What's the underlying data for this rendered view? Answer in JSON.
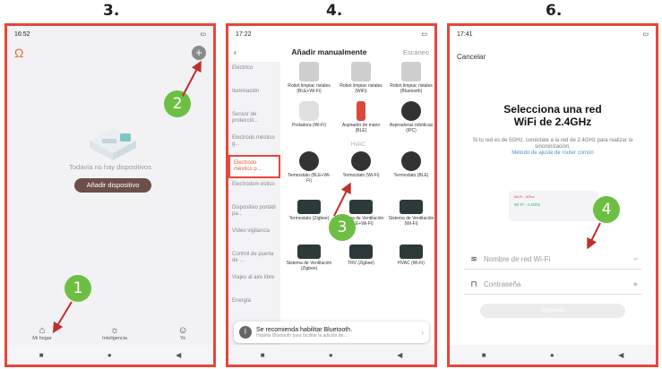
{
  "steps": [
    "3.",
    "4.",
    "6."
  ],
  "markers": [
    "1",
    "2",
    "3",
    "4"
  ],
  "phone1": {
    "time": "16:52",
    "signal": "ail",
    "empty_text": "Todavía no hay dispositivos",
    "add_device": "Añadir dispositivo",
    "tabs": [
      "Mi hogar",
      "Inteligencia",
      "Yo"
    ]
  },
  "phone2": {
    "time": "17:22",
    "title": "Añadir manualmente",
    "scan": "Escaneo",
    "categories": [
      "Eléctrico",
      "Iluminación",
      "Sensor de protecció...",
      "Electrodo méstico g...",
      "Electrodo méstico p...",
      "Electrodom éstico",
      "Dispositivo portátil pa...",
      "Vídeo vigilancia",
      "Control de puerta de ...",
      "Viajes al aire libre",
      "Energía"
    ],
    "section": "HVAC",
    "devices": [
      {
        "name": "Robot limpiac ristales (BLE+Wi-Fi)"
      },
      {
        "name": "Robot limpiac ristales (WiFi)"
      },
      {
        "name": "Robot limpiac ristales (Bluetooth)"
      },
      {
        "name": "Podadora (Wi-Fi)"
      },
      {
        "name": "Aspirador de mano (BLE)"
      },
      {
        "name": "Aspiradoras robóticas (IPC)"
      },
      {
        "name": "Termostato (BLE+Wi-Fi)"
      },
      {
        "name": "Termostato (Wi-Fi)"
      },
      {
        "name": "Termostato (BLE)"
      },
      {
        "name": "Termostato (Zigbee)"
      },
      {
        "name": "Sistema de Ventilación (BLE+Wi-Fi)"
      },
      {
        "name": "Sistema de Ventilación (Wi-Fi)"
      },
      {
        "name": "Sistema de Ventilación (Zigbee)"
      },
      {
        "name": "TRV (Zigbee)"
      },
      {
        "name": "HVAC (Wi-Fi)"
      }
    ],
    "toast_title": "Se recomienda habilitar Bluetooth.",
    "toast_sub": "Habilite Bluetooth para facilitar la adición de..."
  },
  "phone3": {
    "time": "17:41",
    "cancel": "Cancelar",
    "title_line1": "Selecciona una red",
    "title_line2": "WiFi de 2.4GHz",
    "desc": "Si tu red es de 5GHz, conéctate a la red de 2.4GHz para realizar la sincronización.",
    "link": "Método de ajuste de router común",
    "router_5g": "Wi-Fi - 5Ghz",
    "router_24g": "Wi-Fi - 2.4Ghz",
    "wifi_placeholder": "Nombre de red Wi-Fi",
    "password_placeholder": "Contraseña",
    "next": "Siguiente"
  },
  "colors": {
    "frame": "#e8463a",
    "marker": "#6dbf43",
    "arrow": "#c0302a",
    "accent": "#e45a3c"
  }
}
